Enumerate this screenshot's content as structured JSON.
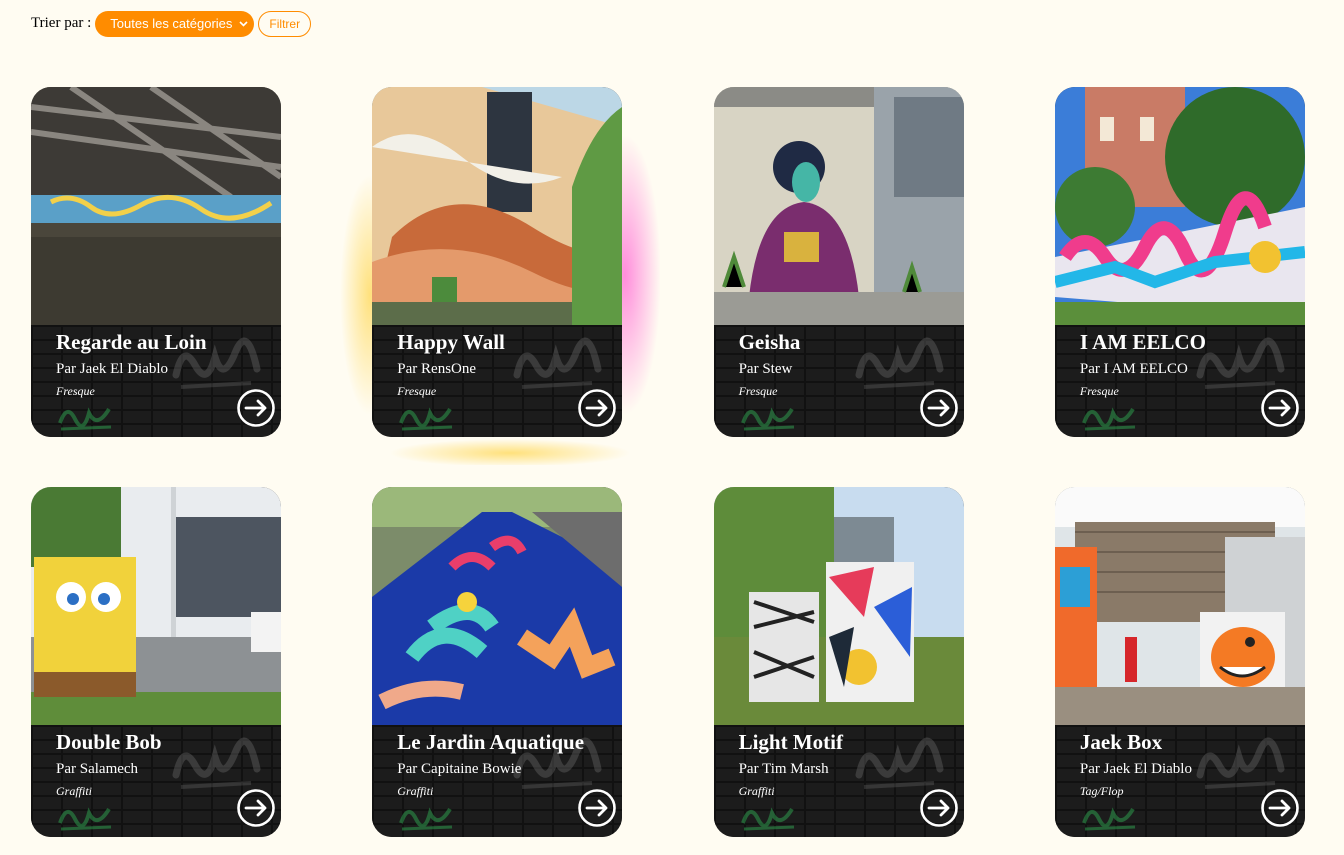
{
  "toolbar": {
    "sort_label": "Trier par :",
    "category_select": "Toutes les catégories",
    "filter_button": "Filtrer"
  },
  "cards": [
    {
      "title": "Regarde au Loin",
      "author": "Par Jaek El Diablo",
      "category": "Fresque",
      "image": "bridge-underpass-mural-photo"
    },
    {
      "title": "Happy Wall",
      "author": "Par RensOne",
      "category": "Fresque",
      "image": "building-wall-mural-photo"
    },
    {
      "title": "Geisha",
      "author": "Par Stew",
      "category": "Fresque",
      "image": "geisha-wall-mural-photo"
    },
    {
      "title": "I AM EELCO",
      "author": "Par I AM EELCO",
      "category": "Fresque",
      "image": "colorful-fence-mural-photo"
    },
    {
      "title": "Double Bob",
      "author": "Par Salamech",
      "category": "Graffiti",
      "image": "spongebob-utility-box-photo"
    },
    {
      "title": "Le Jardin Aquatique",
      "author": "Par Capitaine Bowie",
      "category": "Graffiti",
      "image": "painted-bike-path-photo"
    },
    {
      "title": "Light Motif",
      "author": "Par Tim Marsh",
      "category": "Graffiti",
      "image": "patterned-utility-boxes-photo"
    },
    {
      "title": "Jaek Box",
      "author": "Par Jaek El Diablo",
      "category": "Tag/Flop",
      "image": "orange-character-box-photo"
    }
  ],
  "colors": {
    "accent": "#ff8c00",
    "background": "#fffcf2",
    "card_body": "#1c1c1c"
  },
  "icons": {
    "select": "chevron-down-icon",
    "card_link": "arrow-right-circle-icon"
  }
}
